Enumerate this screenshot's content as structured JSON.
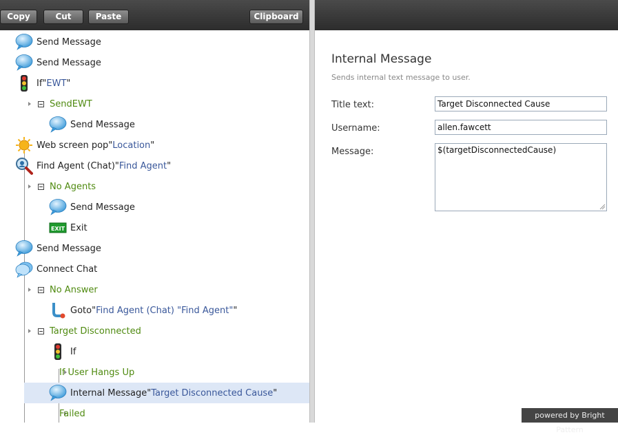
{
  "toolbar": {
    "copy_label": "Copy",
    "cut_label": "Cut",
    "paste_label": "Paste",
    "clipboard_label": "Clipboard"
  },
  "tree": [
    {
      "icon": "speech-bubble",
      "label": "Send Message"
    },
    {
      "icon": "speech-bubble",
      "label": "Send Message"
    },
    {
      "icon": "traffic-light",
      "label": "If ",
      "quoted": "EWT"
    },
    {
      "branch": "SendEWT"
    },
    {
      "icon": "speech-bubble",
      "label": "Send Message"
    },
    {
      "icon": "sun",
      "label": "Web screen pop ",
      "quoted": "Location"
    },
    {
      "icon": "magnifier",
      "label": "Find Agent (Chat) ",
      "quoted": "Find Agent"
    },
    {
      "branch": "No Agents"
    },
    {
      "icon": "speech-bubble",
      "label": "Send Message"
    },
    {
      "icon": "exit",
      "icon_text": "EXIT",
      "label": "Exit"
    },
    {
      "icon": "speech-bubble",
      "label": "Send Message"
    },
    {
      "icon": "speech-bubble-double",
      "label": "Connect Chat"
    },
    {
      "branch": "No Answer"
    },
    {
      "icon": "goto-arrow",
      "label": "Goto ",
      "quoted": "Find Agent (Chat) \"Find Agent\""
    },
    {
      "branch": "Target Disconnected"
    },
    {
      "icon": "traffic-light",
      "label": "If"
    },
    {
      "branch": "If User Hangs Up"
    },
    {
      "icon": "speech-bubble",
      "label": "Internal Message ",
      "quoted": "Target Disconnected Cause",
      "selected": true
    },
    {
      "branch": "Failed"
    }
  ],
  "properties": {
    "title": "Internal Message",
    "subtitle": "Sends internal text message to user.",
    "title_text_label": "Title text:",
    "title_text_value": "Target Disconnected Cause",
    "username_label": "Username:",
    "username_value": "allen.fawcett",
    "message_label": "Message:",
    "message_value": "$(targetDisconnectedCause)"
  },
  "footer": {
    "powered_by": "powered by Bright Pattern"
  },
  "colors": {
    "toolbar_bg": "#3a3a3a",
    "selection_bg": "#dde7f6",
    "param_text": "#39579a",
    "branch_text": "#4f8a10"
  }
}
